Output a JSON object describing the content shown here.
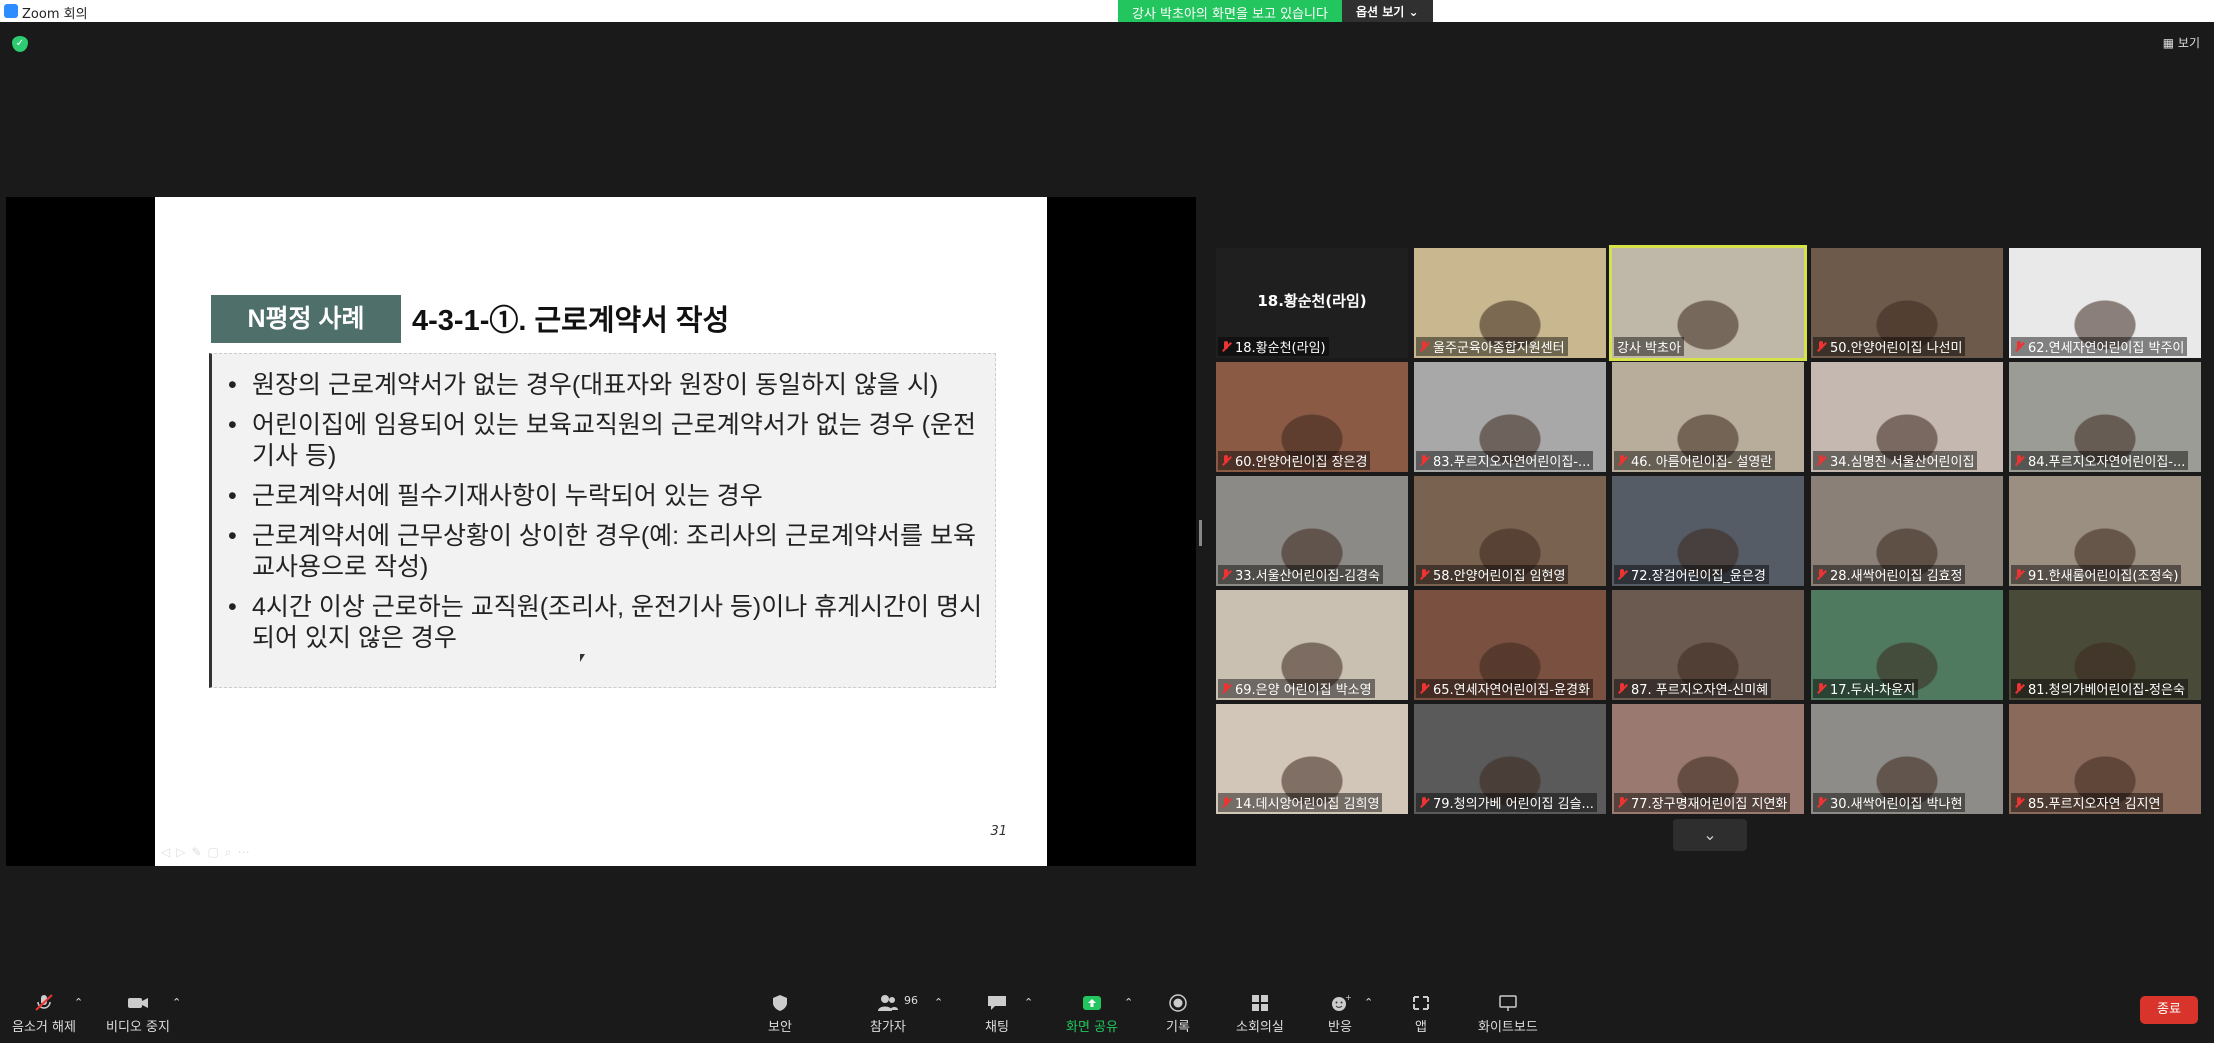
{
  "window": {
    "title": "Zoom 회의"
  },
  "banner": {
    "sharing_text": "강사 박초아의 화면을 보고 있습니다",
    "options_label": "옵션 보기 ⌄"
  },
  "view_label": "보기",
  "slide": {
    "tag": "N평정 사례",
    "heading": "4-3-1-①. 근로계약서 작성",
    "bullets": [
      "원장의 근로계약서가 없는 경우(대표자와 원장이 동일하지 않을 시)",
      "어린이집에 임용되어 있는 보육교직원의 근로계약서가 없는 경우 (운전기사 등)",
      "근로계약서에 필수기재사항이 누락되어 있는 경우",
      "근로계약서에 근무상황이 상이한 경우(예: 조리사의 근로계약서를 보육교사용으로 작성)",
      "4시간 이상 근로하는 교직원(조리사, 운전기사 등)이나 휴게시간이 명시되어 있지 않은 경우"
    ],
    "page_number": "31",
    "controls": "◁▷✎▢⌕⋯"
  },
  "participants": [
    {
      "name": "18.황순천(라임)",
      "center": "18.황순천(라임)",
      "color": "#1f1f1f"
    },
    {
      "name": "울주군육아종합지원센터",
      "color": "#c9b88f"
    },
    {
      "name": "강사 박초아",
      "color": "#bfb7a8",
      "active": true
    },
    {
      "name": "50.안양어린이집 나선미",
      "color": "#6e5a4a"
    },
    {
      "name": "62.연세자연어린이집 박주이",
      "color": "#e9e9e9"
    },
    {
      "name": "60.안양어린이집 장은경",
      "color": "#8a5a45"
    },
    {
      "name": "83.푸르지오자연어린이집-...",
      "color": "#a8a8a8"
    },
    {
      "name": "46. 아름어린이집- 설영란",
      "color": "#b8ad9a"
    },
    {
      "name": "34.심명진 서울산어린이집",
      "color": "#c4b8b0"
    },
    {
      "name": "84.푸르지오자연어린이집-...",
      "color": "#9c9c96"
    },
    {
      "name": "33.서울산어린이집-김경숙",
      "color": "#8c8a86"
    },
    {
      "name": "58.안양어린이집 임현영",
      "color": "#7a6250"
    },
    {
      "name": "72.장검어린이집_윤은경",
      "color": "#555c66"
    },
    {
      "name": "28.새싹어린이집 김효정",
      "color": "#8a8078"
    },
    {
      "name": "91.한새롬어린이집(조정숙)",
      "color": "#9a8f80"
    },
    {
      "name": "69.은양 어린이집 박소영",
      "color": "#c9c0b2"
    },
    {
      "name": "65.연세자연어린이집-윤경화",
      "color": "#7a5040"
    },
    {
      "name": "87. 푸르지오자연-신미혜",
      "color": "#6a5a50"
    },
    {
      "name": "17.두서-차윤지",
      "color": "#4f7a60"
    },
    {
      "name": "81.청의가베어린이집-정은숙",
      "color": "#4a4a38"
    },
    {
      "name": "14.데시앙어린이집 김희영",
      "color": "#d2c6b8"
    },
    {
      "name": "79.청의가베 어린이집 김슬...",
      "color": "#5a5a5a"
    },
    {
      "name": "77.장구명재어린이집 지연화",
      "color": "#9a7a70"
    },
    {
      "name": "30.새싹어린이집 박나현",
      "color": "#8e8c88"
    },
    {
      "name": "85.푸르지오자연 김지연",
      "color": "#8a6a5a"
    }
  ],
  "more_label": "⌄",
  "toolbar": {
    "unmute": "음소거 해제",
    "stop_video": "비디오 중지",
    "security": "보안",
    "participants": "참가자",
    "participant_count": "96",
    "chat": "채팅",
    "share": "화면 공유",
    "record": "기록",
    "breakout": "소회의실",
    "reactions": "반응",
    "apps": "앱",
    "whiteboard": "화이트보드",
    "end": "종료"
  },
  "colors": {
    "accent_green": "#23c55e",
    "end_red": "#d9342b",
    "slide_tag": "#4f6f6b"
  }
}
